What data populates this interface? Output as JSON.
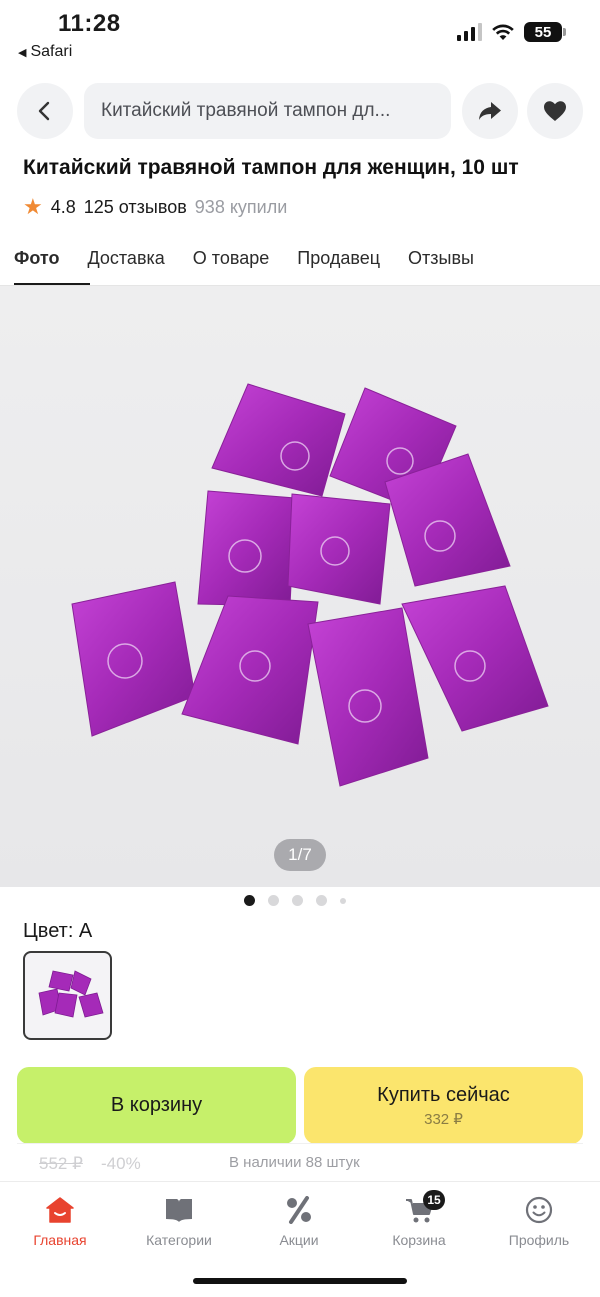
{
  "status_bar": {
    "time": "11:28",
    "back_app": "Safari",
    "battery": "55"
  },
  "topbar": {
    "search_text": "Китайский травяной тампон дл..."
  },
  "product": {
    "title": "Китайский травяной тампон для женщин, 10 шт",
    "rating": "4.8",
    "reviews": "125 отзывов",
    "bought": "938 купили"
  },
  "tabs": [
    {
      "label": "Фото"
    },
    {
      "label": "Доставка"
    },
    {
      "label": "О товаре"
    },
    {
      "label": "Продавец"
    },
    {
      "label": "Отзывы"
    }
  ],
  "gallery": {
    "counter": "1/7",
    "current_index": 1,
    "total": 7
  },
  "color": {
    "label": "Цвет: A"
  },
  "actions": {
    "cart_label": "В корзину",
    "buy_label": "Купить сейчас",
    "buy_price": "332 ₽",
    "old_price": "552 ₽",
    "discount": "-40%",
    "stock": "В наличии 88 штук"
  },
  "bottom_nav": [
    {
      "label": "Главная",
      "icon": "home-icon"
    },
    {
      "label": "Категории",
      "icon": "book-icon"
    },
    {
      "label": "Акции",
      "icon": "percent-icon"
    },
    {
      "label": "Корзина",
      "icon": "cart-icon",
      "badge": "15"
    },
    {
      "label": "Профиль",
      "icon": "smile-icon"
    }
  ],
  "colors": {
    "accent_red": "#e8432f",
    "cart_green": "#c6f06a",
    "buy_yellow": "#fbe56d",
    "star_orange": "#f08a34",
    "sachet_purple": "#a52ab8"
  }
}
